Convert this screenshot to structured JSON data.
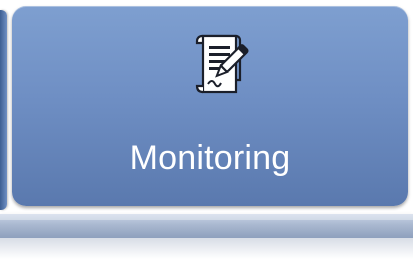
{
  "tile": {
    "label": "Monitoring",
    "icon": "document-edit-icon"
  },
  "colors": {
    "tile_top": "#7e9fd0",
    "tile_bottom": "#5a79ae",
    "label": "#ffffff",
    "base_bar": "#a9b8d0"
  }
}
